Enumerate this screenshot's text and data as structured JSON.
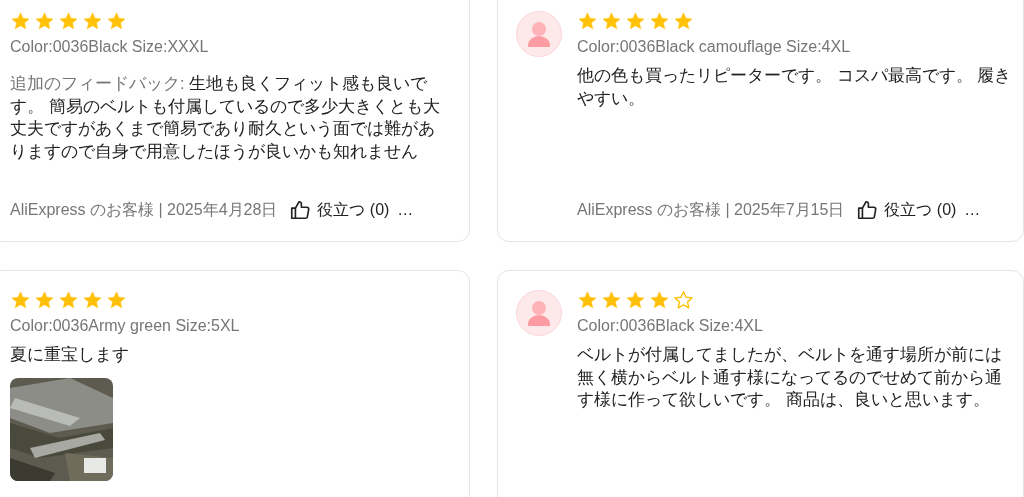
{
  "reviews": [
    {
      "avatar": false,
      "stars": 5,
      "variant": "Color:0036Black Size:XXXL",
      "feedback_label": "追加のフィードバック:",
      "text": "生地も良くフィット感も良いです。 簡易のベルトも付属しているので多少大きくとも大丈夫ですがあくまで簡易であり耐久という面では難がありますので自身で用意したほうが良いかも知れません",
      "author_date": "AliExpress のお客様 | 2025年4月28日",
      "helpful": "役立つ (0)",
      "more": "…"
    },
    {
      "avatar": true,
      "stars": 5,
      "variant": "Color:0036Black camouflage Size:4XL",
      "text": "他の色も買ったリピーターです。 コスパ最高です。 履きやすい。",
      "author_date": "AliExpress のお客様 | 2025年7月15日",
      "helpful": "役立つ (0)",
      "more": "…"
    },
    {
      "avatar": false,
      "stars": 5,
      "variant": "Color:0036Army green Size:5XL",
      "text": "夏に重宝します",
      "photos": [
        {
          "kind": "picture"
        }
      ]
    },
    {
      "avatar": true,
      "stars": 4,
      "variant": "Color:0036Black Size:4XL",
      "text": "ベルトが付属してましたが、ベルトを通す場所が前には無く横からベルト通す様になってるのでせめて前から通す様に作って欲しいです。 商品は、良いと思います。"
    }
  ]
}
